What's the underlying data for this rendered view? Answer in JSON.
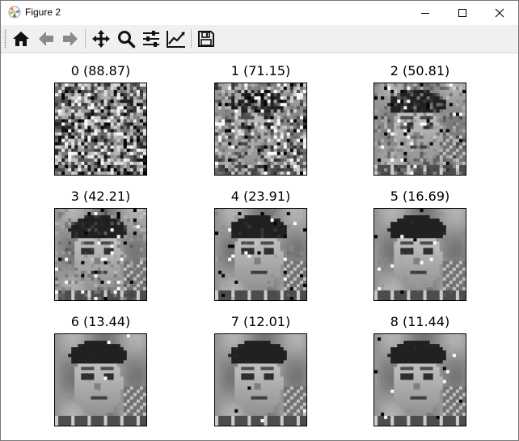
{
  "window": {
    "title": "Figure 2",
    "app_icon": "matplotlib-icon",
    "controls": [
      "minimize-icon",
      "maximize-icon",
      "close-icon"
    ]
  },
  "toolbar": {
    "buttons": [
      {
        "name": "home",
        "icon": "home-icon"
      },
      {
        "name": "back",
        "icon": "arrow-left-icon"
      },
      {
        "name": "forward",
        "icon": "arrow-right-icon"
      },
      {
        "name": "pan",
        "icon": "move-icon"
      },
      {
        "name": "zoom",
        "icon": "magnifier-icon"
      },
      {
        "name": "subplots",
        "icon": "sliders-icon"
      },
      {
        "name": "customize",
        "icon": "line-chart-icon"
      },
      {
        "name": "save",
        "icon": "floppy-disk-icon"
      }
    ]
  },
  "figure": {
    "subplots": [
      {
        "title": "0 (88.87)",
        "error": 88.87
      },
      {
        "title": "1 (71.15)",
        "error": 71.15
      },
      {
        "title": "2 (50.81)",
        "error": 50.81
      },
      {
        "title": "3 (42.21)",
        "error": 42.21
      },
      {
        "title": "4 (23.91)",
        "error": 23.91
      },
      {
        "title": "5 (16.69)",
        "error": 16.69
      },
      {
        "title": "6 (13.44)",
        "error": 13.44
      },
      {
        "title": "7 (12.01)",
        "error": 12.01
      },
      {
        "title": "8 (11.44)",
        "error": 11.44
      }
    ]
  }
}
